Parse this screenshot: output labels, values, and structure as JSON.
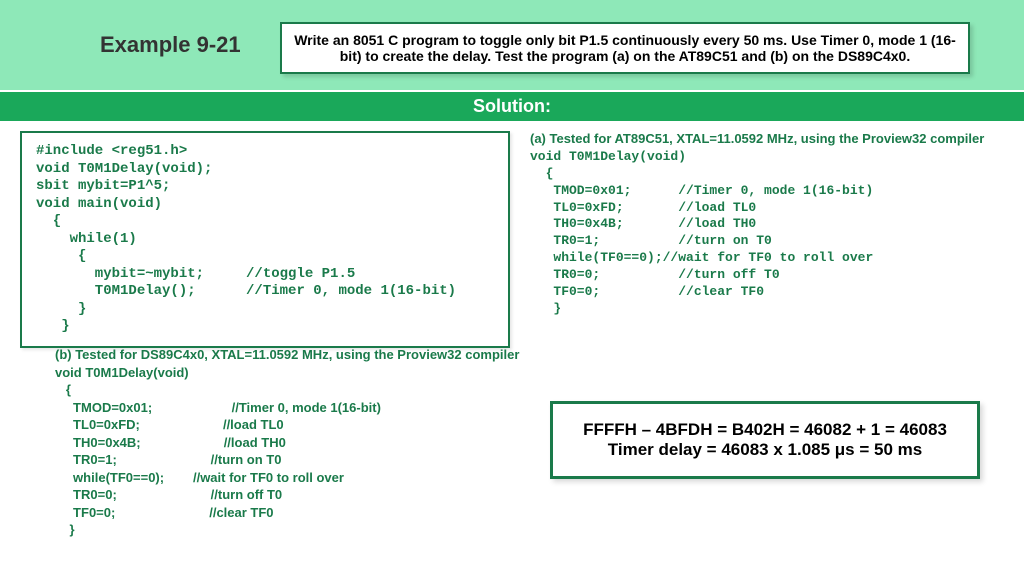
{
  "header": {
    "example_title": "Example 9-21",
    "problem": "Write an 8051 C program to toggle only bit P1.5 continuously every 50 ms.  Use Timer 0, mode 1 (16-bit) to create the delay.  Test the program (a) on the AT89C51 and (b) on the DS89C4x0."
  },
  "solution_label": "Solution:",
  "main_code": "#include <reg51.h>\nvoid T0M1Delay(void);\nsbit mybit=P1^5;\nvoid main(void)\n  {\n    while(1)\n     {\n       mybit=~mybit;     //toggle P1.5\n       T0M1Delay();      //Timer 0, mode 1(16-bit)\n     }\n   }",
  "part_a": {
    "label": "(a) Tested for AT89C51, XTAL=11.0592 MHz, using the Proview32 compiler",
    "sig": "void T0M1Delay(void)",
    "body": "  {\n   TMOD=0x01;      //Timer 0, mode 1(16-bit)\n   TL0=0xFD;       //load TL0\n   TH0=0x4B;       //load TH0\n   TR0=1;          //turn on T0\n   while(TF0==0);//wait for TF0 to roll over\n   TR0=0;          //turn off T0\n   TF0=0;          //clear TF0\n   }"
  },
  "part_b": {
    "label": "(b) Tested for DS89C4x0, XTAL=11.0592 MHz, using the Proview32 compiler",
    "sig": "void T0M1Delay(void)",
    "lines": [
      "   {",
      "     TMOD=0x01;                      //Timer 0, mode 1(16-bit)",
      "     TL0=0xFD;                       //load TL0",
      "     TH0=0x4B;                       //load TH0",
      "     TR0=1;                          //turn on T0",
      "     while(TF0==0);        //wait for TF0 to roll over",
      "     TR0=0;                          //turn off T0",
      "     TF0=0;                          //clear TF0",
      "    }"
    ]
  },
  "calc": {
    "line1": "FFFFH – 4BFDH = B402H = 46082 + 1 = 46083",
    "line2": "Timer delay = 46083 x 1.085 μs = 50 ms"
  }
}
